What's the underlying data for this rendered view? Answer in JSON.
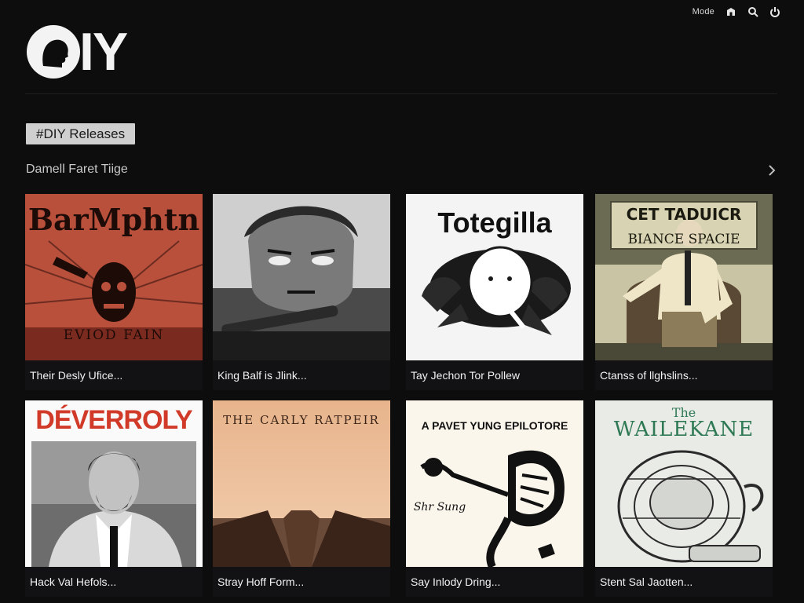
{
  "header": {
    "mode_label": "Mode",
    "logo_text": "IY",
    "icons": [
      "store-icon",
      "search-icon",
      "power-icon"
    ]
  },
  "section": {
    "chip_label": "#DIY Releases",
    "title": "Damell Faret Tiige"
  },
  "colors": {
    "background": "#0d0d0e",
    "chip": "#cfcfcf",
    "caption_bg": "#121214"
  },
  "cards": [
    {
      "caption": "Their Desly Ufice...",
      "art_title": "BarMphtn",
      "art_subtitle": "EVIOD FAIN",
      "art_style": "red-woodcut-skull"
    },
    {
      "caption": "King Balf is Jlink...",
      "art_title": "",
      "art_style": "grey-engraved-face"
    },
    {
      "caption": "Tay Jechon Tor Pollew",
      "art_title": "Totegilla",
      "art_style": "white-ink-creature"
    },
    {
      "caption": "Ctanss of llghslins...",
      "art_title": "CET TADUICR",
      "art_subtitle": "BIANCE SPACIE",
      "art_style": "sepia-seated-man"
    },
    {
      "caption": "Hack Val Hefols...",
      "art_title": "DÉVERROLY",
      "art_style": "bw-portrait"
    },
    {
      "caption": "Stray Hoff Form...",
      "art_title": "THE CARLY RATPEIR",
      "art_style": "peach-pier"
    },
    {
      "caption": "Say Inlody Dring...",
      "art_title": "A PAVET YUNG EPILOTORE",
      "art_subtitle": "Shr Sung",
      "art_style": "ink-butterfly"
    },
    {
      "caption": "Stent Sal Jaotten...",
      "art_title": "WAILEKANE",
      "art_subtitle": "The",
      "art_style": "green-etched-ornament"
    }
  ]
}
